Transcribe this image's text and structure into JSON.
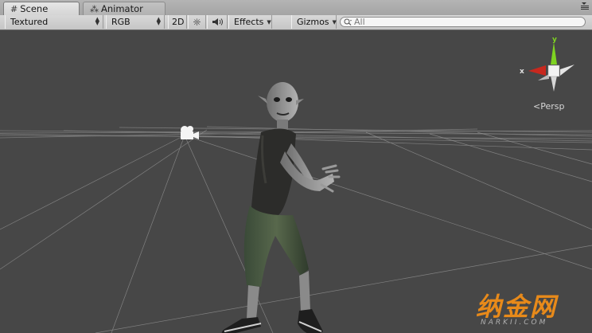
{
  "tabs": [
    {
      "label": "Scene",
      "icon": "grid-icon",
      "active": true
    },
    {
      "label": "Animator",
      "icon": "animator-icon",
      "active": false
    }
  ],
  "toolbar": {
    "draw_mode": "Textured",
    "render_mode": "RGB",
    "mode_2d": "2D",
    "effects": "Effects",
    "gizmos": "Gizmos",
    "search_placeholder": "All"
  },
  "gizmo": {
    "axis_x": "x",
    "axis_y": "y",
    "projection": "Persp",
    "x_color": "#c8281e",
    "y_color": "#7ed321"
  },
  "watermark": {
    "main": "纳金网",
    "sub": "NARKII.COM"
  },
  "colors": {
    "viewport_bg": "#474747",
    "grid_line": "#8e8e8e",
    "toolbar_bg": "#cfcfcf"
  }
}
